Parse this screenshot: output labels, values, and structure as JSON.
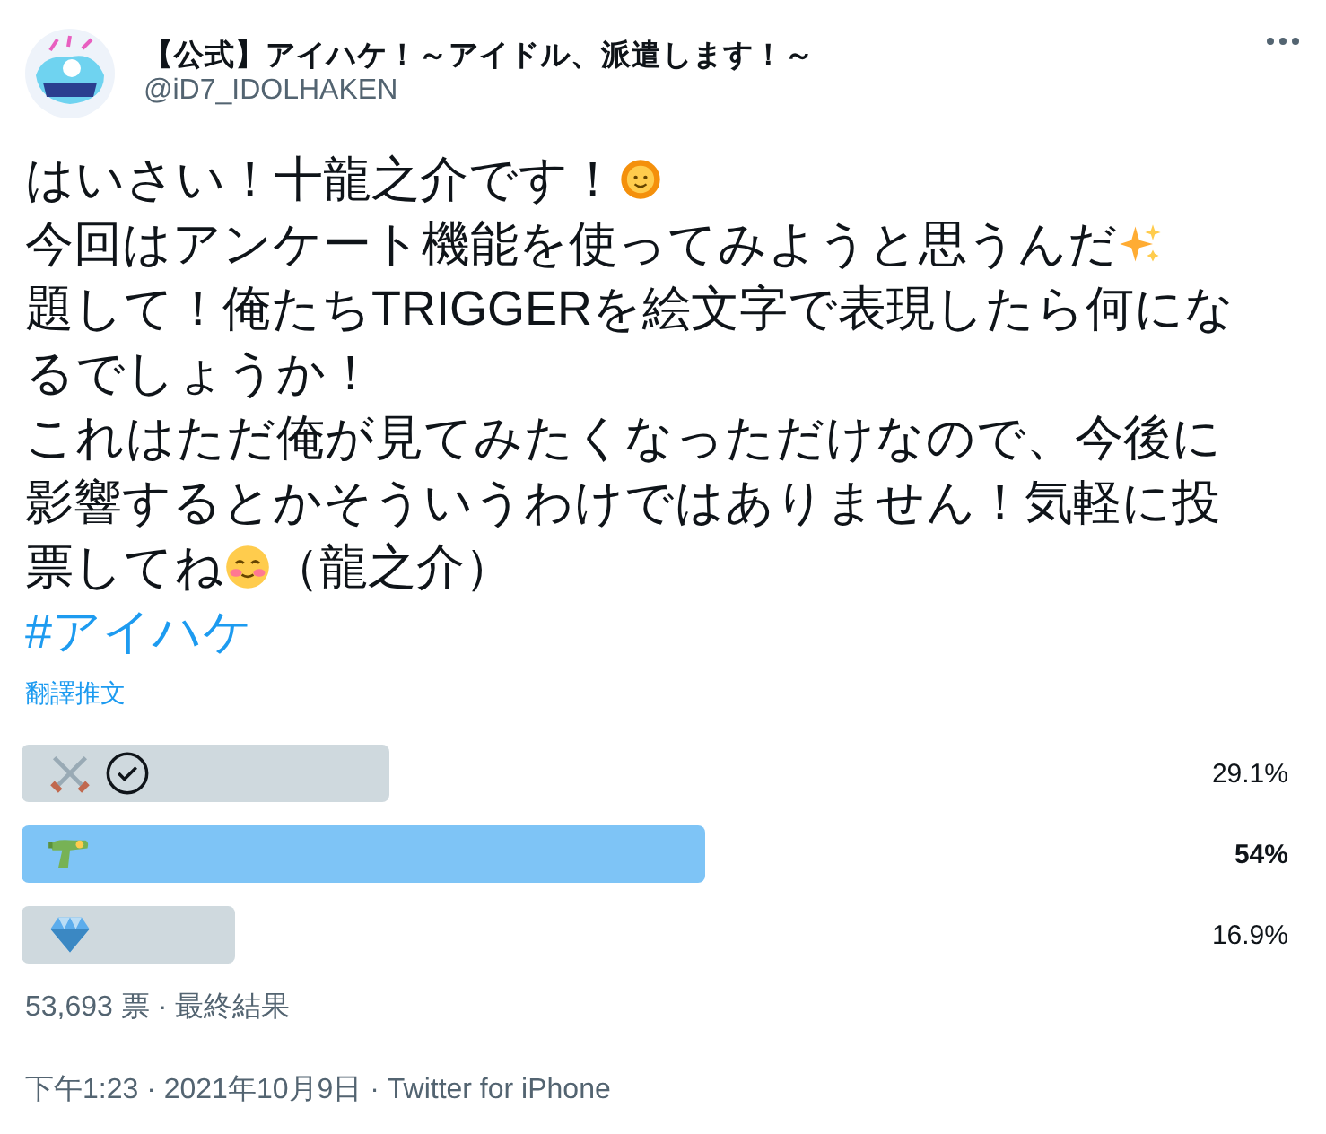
{
  "account": {
    "name": "【公式】アイハケ！～アイドル、派遣します！～",
    "handle": "@iD7_IDOLHAKEN"
  },
  "paragraphs": [
    [
      {
        "kind": "text",
        "text": "はいさい！十龍之介です！"
      },
      {
        "kind": "sun"
      }
    ],
    [
      {
        "kind": "text",
        "text": "今回はアンケート機能を使ってみようと思うんだ"
      },
      {
        "kind": "sparkles"
      }
    ],
    [
      {
        "kind": "text",
        "text": "題して！俺たちTRIGGERを絵文字で表現したら何にな"
      }
    ],
    [
      {
        "kind": "text",
        "text": "るでしょうか！"
      }
    ],
    [
      {
        "kind": "text",
        "text": "これはただ俺が見てみたくなっただけなので、今後に"
      }
    ],
    [
      {
        "kind": "text",
        "text": "影響するとかそういうわけではありません！気軽に投"
      }
    ],
    [
      {
        "kind": "text",
        "text": "票してね"
      },
      {
        "kind": "smile"
      },
      {
        "kind": "text",
        "text": "（龍之介）"
      }
    ],
    [
      {
        "kind": "hashtag",
        "text": "#アイハケ"
      }
    ]
  ],
  "translate_link": "翻譯推文",
  "poll": {
    "options": [
      {
        "kind": "swords",
        "voted": true,
        "selected": false,
        "level": 0.291,
        "percent": "29.1%"
      },
      {
        "kind": "water-gun",
        "voted": false,
        "selected": true,
        "level": 0.54,
        "percent": "54%"
      },
      {
        "kind": "gem",
        "voted": false,
        "selected": false,
        "level": 0.169,
        "percent": "16.9%"
      }
    ],
    "summary": "53,693 票 · 最終結果"
  },
  "timestamp": "下午1:23 · 2021年10月9日 · Twitter for iPhone"
}
